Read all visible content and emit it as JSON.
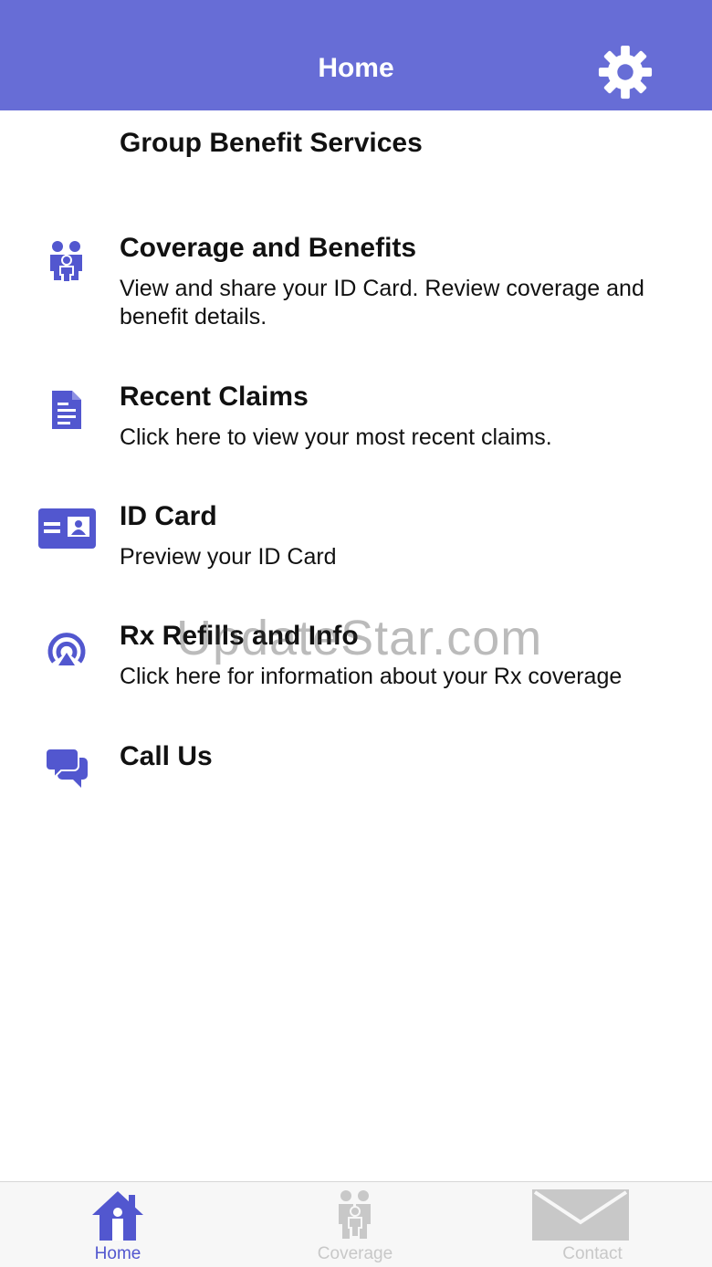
{
  "header": {
    "title": "Home"
  },
  "subtitle": "Group Benefit Services",
  "menu": [
    {
      "title": "Coverage and Benefits",
      "description": "View and share your ID Card. Review coverage and benefit details.",
      "icon": "family-icon"
    },
    {
      "title": "Recent Claims",
      "description": "Click here to view your most recent claims.",
      "icon": "document-icon"
    },
    {
      "title": "ID Card",
      "description": "Preview your ID Card",
      "icon": "id-card-icon"
    },
    {
      "title": "Rx Refills and Info",
      "description": "Click here for information about your Rx coverage",
      "icon": "rx-signal-icon"
    },
    {
      "title": "Call Us",
      "description": "",
      "icon": "chat-icon"
    }
  ],
  "watermark": "UpdateStar.com",
  "tabs": [
    {
      "label": "Home",
      "icon": "home-icon",
      "active": true
    },
    {
      "label": "Coverage",
      "icon": "family-icon",
      "active": false
    },
    {
      "label": "Contact",
      "icon": "envelope-icon",
      "active": false
    }
  ],
  "colors": {
    "accent": "#676dd6",
    "icon": "#5257cf",
    "inactive_tab": "#c8c8c8"
  }
}
